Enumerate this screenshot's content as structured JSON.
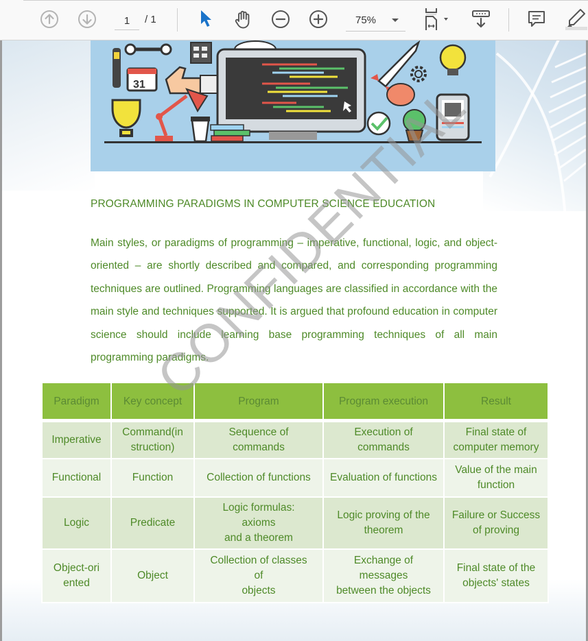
{
  "toolbar": {
    "prev_page_icon": "arrow-up-circle-icon",
    "next_page_icon": "arrow-down-circle-icon",
    "current_page": "1",
    "total_pages": "/ 1",
    "select_tool_icon": "pointer-arrow-icon",
    "hand_tool_icon": "hand-icon",
    "zoom_out_icon": "minus-circle-icon",
    "zoom_in_icon": "plus-circle-icon",
    "zoom_level": "75%",
    "fit_page_icon": "fit-page-icon",
    "scroll_mode_icon": "scroll-mode-icon",
    "comment_icon": "comment-icon",
    "highlight_icon": "highlighter-icon",
    "active_tool": "select",
    "accent_color": "#1a73c9"
  },
  "document": {
    "banner_image": "programming-workspace-illustration",
    "title": "PROGRAMMING PARADIGMS IN COMPUTER SCIENCE EDUCATION",
    "abstract": "Main styles, or paradigms of programming – imperative, functional, logic, and object-oriented – are shortly described and compared, and corresponding programming techniques are outlined. Programming languages are classified in accordance with the main style and techniques supported. It is argued that profound education in computer science should include learning base programming techniques of all main programming paradigms.",
    "watermark": "CONFIDENTIAL",
    "text_color": "#4e8a28",
    "table": {
      "headers": [
        "Paradigm",
        "Key concept",
        "Program",
        "Program execution",
        "Result"
      ],
      "rows": [
        [
          "Imperative",
          "Command(in\nstruction)",
          "Sequence of\ncommands",
          "Execution of\ncommands",
          "Final state of\ncomputer memory"
        ],
        [
          "Functional",
          "Function",
          "Collection of functions",
          "Evaluation of functions",
          "Value of the main\nfunction"
        ],
        [
          "Logic",
          "Predicate",
          "Logic formulas:\naxioms\nand a theorem",
          "Logic proving of the\ntheorem",
          "Failure or Success\nof proving"
        ],
        [
          "Object-ori\nented",
          "Object",
          "Collection of classes\nof\nobjects",
          "Exchange of\nmessages\nbetween the objects",
          "Final state of the\nobjects' states"
        ]
      ],
      "header_color": "#8dbf3f",
      "row_color_odd": "#dce8cf",
      "row_color_even": "#eef4e9"
    }
  }
}
